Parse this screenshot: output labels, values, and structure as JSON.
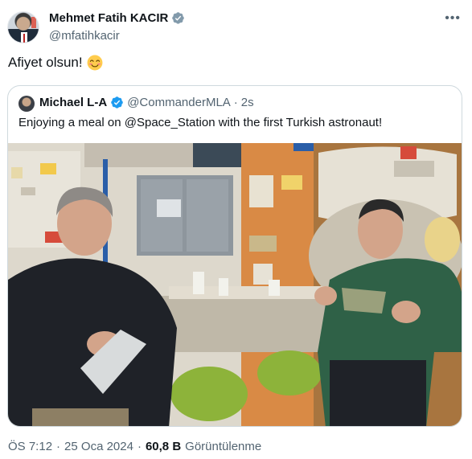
{
  "author": {
    "name": "Mehmet Fatih KACIR",
    "handle": "@mfatihkacir",
    "verified_icon": "verified-badge-gray"
  },
  "tweet": {
    "text": "Afiyet olsun!",
    "emoji_icon": "smiling-face-icon"
  },
  "quoted": {
    "name": "Michael L-A",
    "handle": "@CommanderMLA",
    "separator": "·",
    "time": "2s",
    "text": "Enjoying a meal on @Space_Station with the first Turkish astronaut!",
    "verified_icon": "verified-badge-blue"
  },
  "footer": {
    "time": "ÖS 7:12",
    "sep1": "·",
    "date": "25 Oca 2024",
    "sep2": "·",
    "views_count": "60,8 B",
    "views_label": "Görüntülenme"
  },
  "colors": {
    "text": "#0f1419",
    "secondary": "#536471",
    "verified_blue": "#1d9bf0",
    "verified_gray": "#829aab",
    "border": "#cfd9de"
  }
}
